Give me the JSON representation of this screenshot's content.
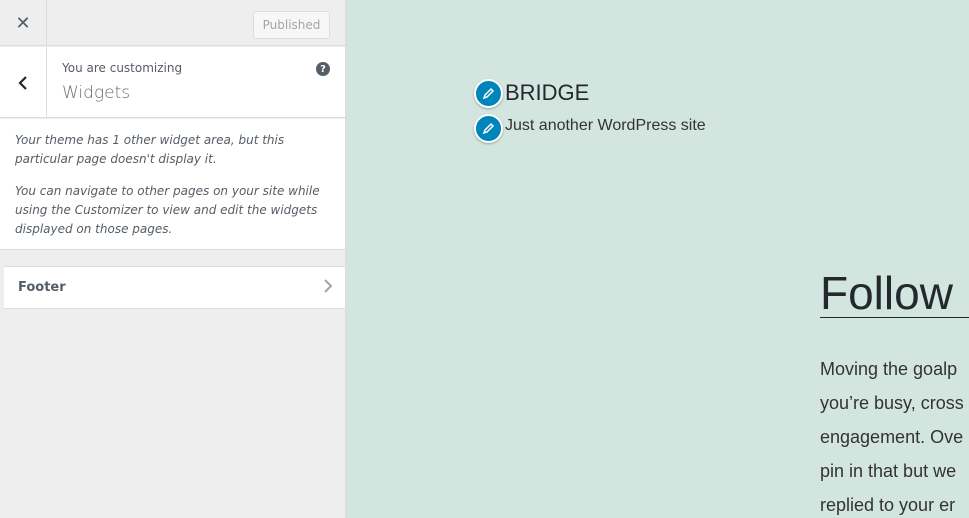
{
  "sidebar": {
    "close_label": "✕",
    "published_label": "Published",
    "section": {
      "meta": "You are customizing",
      "title": "Widgets",
      "help_label": "?"
    },
    "notice": [
      "Your theme has 1 other widget area, but this particular page doesn't display it.",
      "You can navigate to other pages on your site while using the Customizer to view and edit the widgets displayed on those pages."
    ],
    "items": [
      {
        "label": "Footer"
      }
    ]
  },
  "preview": {
    "site_title": "BRIDGE",
    "site_description": "Just another WordPress site",
    "widget_title": "Follow",
    "widget_text_lines": [
      "Moving the goalp",
      "you’re busy, cross",
      "engagement. Ove",
      "pin in that but we",
      "replied to your er"
    ],
    "accent_color": "#0085ba",
    "background_color": "#d3e5df"
  }
}
